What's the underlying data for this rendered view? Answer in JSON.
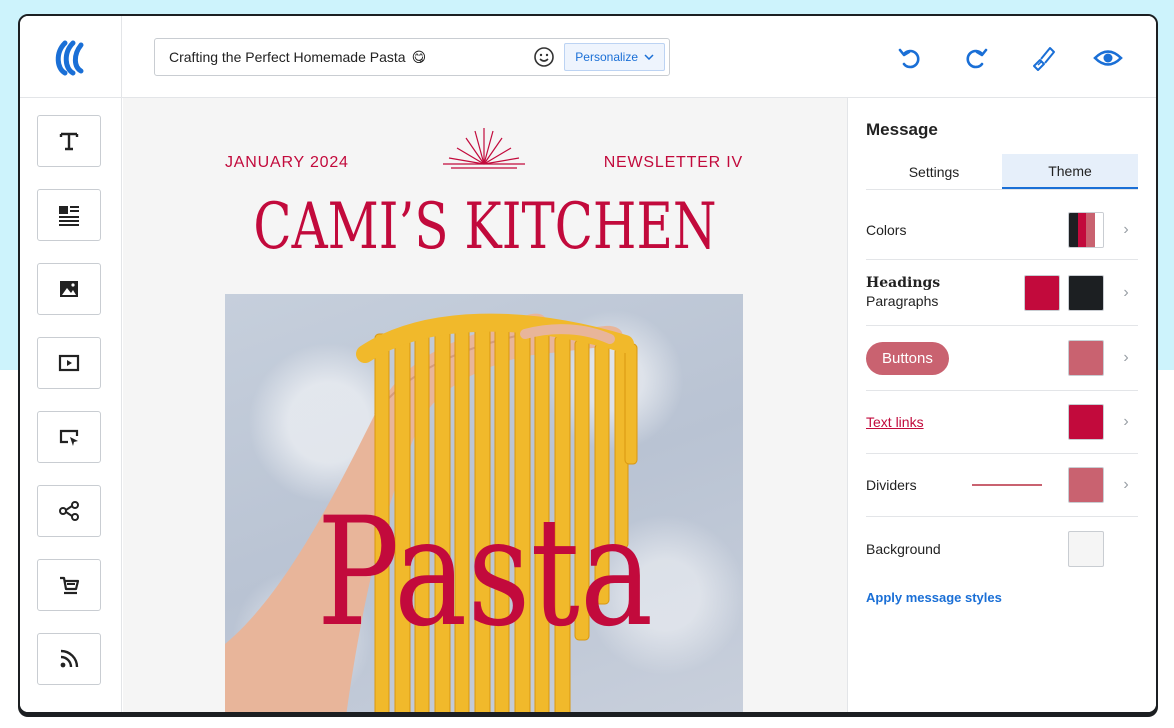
{
  "header": {
    "subject": "Crafting the Perfect Homemade Pasta",
    "subject_emoji": "😋",
    "personalize_label": "Personalize"
  },
  "newsletter": {
    "date": "JANUARY 2024",
    "issue": "NEWSLETTER IV",
    "title": "CAMI’S KITCHEN",
    "hero_word": "Pasta"
  },
  "panel": {
    "title": "Message",
    "tabs": [
      {
        "label": "Settings",
        "active": false
      },
      {
        "label": "Theme",
        "active": true
      }
    ],
    "rows": {
      "colors": {
        "label": "Colors",
        "swatch_colors": [
          "#1c1f22",
          "#c20a3c",
          "#c96270",
          "#ffffff"
        ]
      },
      "headings": {
        "heading_label": "Headings",
        "paragraph_label": "Paragraphs",
        "heading_color": "#c20a3c",
        "paragraph_color": "#1c1f22"
      },
      "buttons": {
        "label": "Buttons",
        "color": "#c96270"
      },
      "text_links": {
        "label": "Text links",
        "color": "#c20a3c"
      },
      "dividers": {
        "label": "Dividers",
        "color": "#c96270"
      },
      "background": {
        "label": "Background",
        "color": "#f5f5f5"
      }
    },
    "apply_label": "Apply message styles"
  },
  "colors": {
    "brand": "#c20a3c",
    "accent": "#1a6fd6"
  },
  "icons": {
    "top": [
      "undo-icon",
      "redo-icon",
      "brush-icon",
      "preview-eye-icon"
    ],
    "tools": [
      "text-icon",
      "text-block-icon",
      "image-icon",
      "video-icon",
      "button-icon",
      "social-share-icon",
      "cart-icon",
      "rss-icon"
    ]
  }
}
